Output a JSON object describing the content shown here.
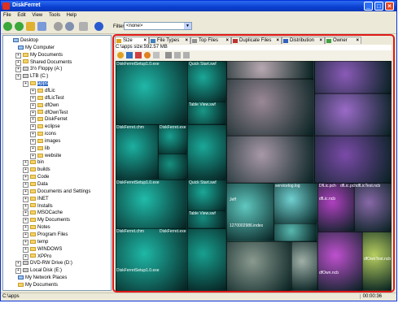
{
  "window": {
    "title": "DiskFerret"
  },
  "menu": [
    "File",
    "Edit",
    "View",
    "Tools",
    "Help"
  ],
  "toolbar": {
    "filter_label": "Filter:",
    "filter_value": "<none>",
    "icons": [
      "back-icon",
      "forward-icon",
      "up-folder-icon",
      "home-icon",
      "drive-icon",
      "network-icon",
      "print-icon",
      "help-icon"
    ]
  },
  "tree": [
    {
      "label": "Desktop",
      "depth": 0,
      "icon": "desktop"
    },
    {
      "label": "My Computer",
      "depth": 1,
      "icon": "pc"
    },
    {
      "label": "My Documents",
      "depth": 2
    },
    {
      "label": "Shared Documents",
      "depth": 2
    },
    {
      "label": "3½ Floppy (A:)",
      "depth": 2,
      "icon": "drv"
    },
    {
      "label": "LTB (C:)",
      "depth": 2,
      "icon": "drv"
    },
    {
      "label": "apps",
      "depth": 3,
      "selected": true
    },
    {
      "label": "dfLic",
      "depth": 4
    },
    {
      "label": "dfLicTest",
      "depth": 4
    },
    {
      "label": "dfOwn",
      "depth": 4
    },
    {
      "label": "dfOwnTest",
      "depth": 4
    },
    {
      "label": "DiskFerret",
      "depth": 4
    },
    {
      "label": "eclipse",
      "depth": 4
    },
    {
      "label": "icons",
      "depth": 4
    },
    {
      "label": "images",
      "depth": 4
    },
    {
      "label": "lib",
      "depth": 4
    },
    {
      "label": "website",
      "depth": 4
    },
    {
      "label": "bin",
      "depth": 3
    },
    {
      "label": "builds",
      "depth": 3
    },
    {
      "label": "Code",
      "depth": 3
    },
    {
      "label": "Data",
      "depth": 3
    },
    {
      "label": "Documents and Settings",
      "depth": 3
    },
    {
      "label": "INET",
      "depth": 3
    },
    {
      "label": "Installs",
      "depth": 3
    },
    {
      "label": "MSOCache",
      "depth": 3
    },
    {
      "label": "My Documents",
      "depth": 3
    },
    {
      "label": "Notes",
      "depth": 3
    },
    {
      "label": "Program Files",
      "depth": 3
    },
    {
      "label": "temp",
      "depth": 3
    },
    {
      "label": "WINDOWS",
      "depth": 3
    },
    {
      "label": "XPPro",
      "depth": 3
    },
    {
      "label": "DVD-RW Drive (D:)",
      "depth": 2,
      "icon": "drv"
    },
    {
      "label": "Local Disk (E:)",
      "depth": 2,
      "icon": "drv"
    },
    {
      "label": "My Network Places",
      "depth": 1,
      "icon": "pc"
    },
    {
      "label": "My Documents",
      "depth": 1
    }
  ],
  "tabs": [
    {
      "label": "Size",
      "active": true,
      "color": "#e0a020"
    },
    {
      "label": "File Types",
      "color": "#4080c0"
    },
    {
      "label": "Top Files",
      "color": "#909090"
    },
    {
      "label": "Duplicate Files",
      "color": "#c03030"
    },
    {
      "label": "Distribution",
      "color": "#3060c0"
    },
    {
      "label": "Owner",
      "color": "#40a040"
    }
  ],
  "path_text": "C:\\apps  size:592.57 MB",
  "treemap_labels": [
    "DiskFerretSetup1.0.exe",
    "Quick Start.swf",
    "Table View.swf",
    "DiskFerret.chm",
    "DiskFerret.exe",
    "DiskFerretSetup1.0.exe",
    "Quick Start.swf",
    "Table View.swf",
    "DiskFerret.chm",
    "DiskFerret.exe",
    "DiskFerretSetup1.0.exe",
    "servicelog.log",
    "DfLic.pch",
    "dfLic.pch",
    "dfLicTest.ncb",
    "dfLic.ncb",
    "1270002986.index",
    "dfOwn.ncb",
    "dfOwnTest.ncb",
    "Jeff"
  ],
  "status": {
    "path": "C:\\apps",
    "time": "00:00:36"
  },
  "colors": {
    "accent": "#e01818",
    "teal": "#20b0a0",
    "purple": "#8a4fb0"
  }
}
